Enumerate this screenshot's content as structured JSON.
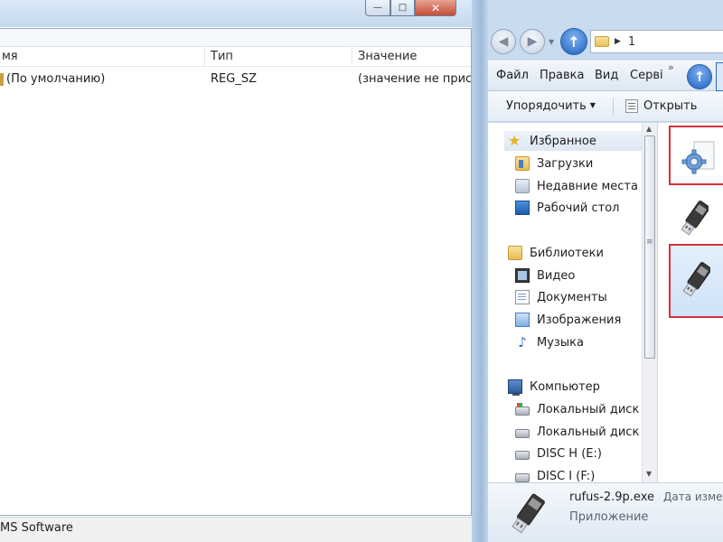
{
  "registry_editor": {
    "window_buttons": {
      "minimize": "—",
      "maximize": "□",
      "close": "✕"
    },
    "columns": {
      "name": "мя",
      "type": "Тип",
      "value": "Значение"
    },
    "rows": [
      {
        "name": "(По умолчанию)",
        "type": "REG_SZ",
        "value": "(значение не присе"
      }
    ],
    "status_path": "MS Software"
  },
  "explorer": {
    "address": {
      "path_segment": "1"
    },
    "menu": {
      "file": "Файл",
      "edit": "Правка",
      "view": "Вид",
      "service": "Серві",
      "overflow": "»"
    },
    "toolbar": {
      "organize": "Упорядочить",
      "organize_caret": "▼",
      "open": "Открыть"
    },
    "nav": {
      "favorites": {
        "label": "Избранное",
        "items": [
          "Загрузки",
          "Недавние места",
          "Рабочий стол"
        ]
      },
      "libraries": {
        "label": "Библиотеки",
        "items": [
          "Видео",
          "Документы",
          "Изображения",
          "Музыка"
        ]
      },
      "computer": {
        "label": "Компьютер",
        "items": [
          "Локальный диск (С",
          "Локальный диск (D",
          "DISC H (E:)",
          "DISC I (F:)"
        ]
      }
    },
    "details": {
      "file_name": "rufus-2.9p.exe",
      "date_label": "Дата изме",
      "file_type": "Приложение"
    }
  }
}
